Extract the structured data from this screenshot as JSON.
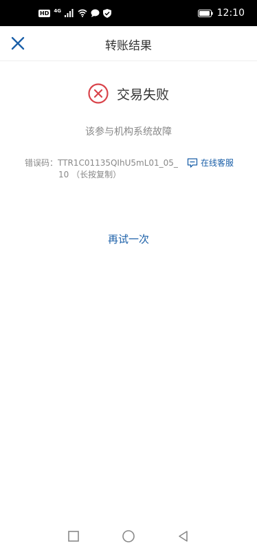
{
  "status_bar": {
    "hd_badge": "HD",
    "network": "4G",
    "time": "12:10",
    "icons": [
      "signal-icon",
      "wifi-icon",
      "message-icon",
      "shield-icon",
      "battery-icon"
    ]
  },
  "header": {
    "title": "转账结果",
    "close_icon": "close-icon"
  },
  "result": {
    "status_text": "交易失败",
    "status_icon": "fail-icon",
    "reason": "该参与机构系统故障"
  },
  "error": {
    "label": "错误码：",
    "code_line1": "TTR1C01135QIhU5mL01_05_",
    "code_line2": "10 （长按复制）"
  },
  "service": {
    "label": "在线客服",
    "icon": "chat-icon"
  },
  "actions": {
    "retry_label": "再试一次"
  },
  "nav_bar": {
    "icons": [
      "recent-apps-icon",
      "home-icon",
      "back-icon"
    ]
  },
  "colors": {
    "accent": "#1a5fa8",
    "error": "#d9434a",
    "text_primary": "#333333",
    "text_secondary": "#888888"
  }
}
